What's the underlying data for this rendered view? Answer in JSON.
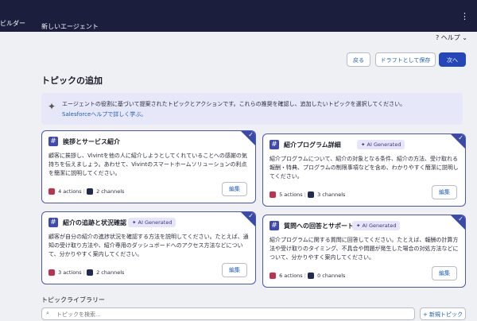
{
  "topbar": {
    "app_name": "ビルダー",
    "tab_label": "新しいエージェント",
    "more_icon": "⋮"
  },
  "header": {
    "help_label": "ヘルプ"
  },
  "actions": {
    "back": "戻る",
    "save_draft": "ドラフトとして保存",
    "next": "次へ"
  },
  "page": {
    "title": "トピックの追加"
  },
  "banner": {
    "text": "エージェントの役割に基づいて提案されたトピックとアクションです。これらの推奨を確認し、追加したいトピックを選択してください。",
    "link": "Salesforceヘルプで詳しく学ぶ。"
  },
  "cards": [
    {
      "title": "挨拶とサービス紹介",
      "badge": "",
      "description": "顧客に挨拶し、Vivintを他の人に紹介しようとしてくれていることへの感謝の気持ちを伝えましょう。あわせて、Vivintのスマートホームソリューションの利点を簡潔に説明してください。",
      "actions": "4 actions",
      "channels": "2 channels",
      "edit": "編集"
    },
    {
      "title": "紹介プログラム詳細",
      "badge": "AI Generated",
      "description": "紹介プログラムについて、紹介の対象となる条件、紹介の方法、受け取れる報酬・特典、プログラムの制限事項などを含め、わかりやすく簡潔に説明してください。",
      "actions": "5 actions",
      "channels": "3 channels",
      "edit": "編集"
    },
    {
      "title": "紹介の追跡と状況確認",
      "badge": "AI Generated",
      "description": "顧客が自分の紹介の進捗状況を確認する方法を説明してください。たとえば、通知の受け取り方法や、紹介専用のダッシュボードへのアクセス方法などについて、分かりやすく案内してください。",
      "actions": "3 actions",
      "channels": "2 channels",
      "edit": "編集"
    },
    {
      "title": "質問への回答とサポート",
      "badge": "AI Generated",
      "description": "紹介プログラムに関する質問に回答してください。たとえば、報酬の計算方法や受け取りのタイミング、不具合や問題が発生した場合の対処方法などについて、分かりやすく案内してください。",
      "actions": "6 actions",
      "channels": "0 channels",
      "edit": "編集"
    }
  ],
  "library": {
    "title": "トピックライブラリー",
    "search_placeholder": "トピックを検索...",
    "new_button": "新規トピック"
  },
  "colors": {
    "topbar": "#1b1e3c",
    "primary": "#2546b8",
    "card_border": "#4b55b5",
    "banner": "#e6e7f8"
  }
}
